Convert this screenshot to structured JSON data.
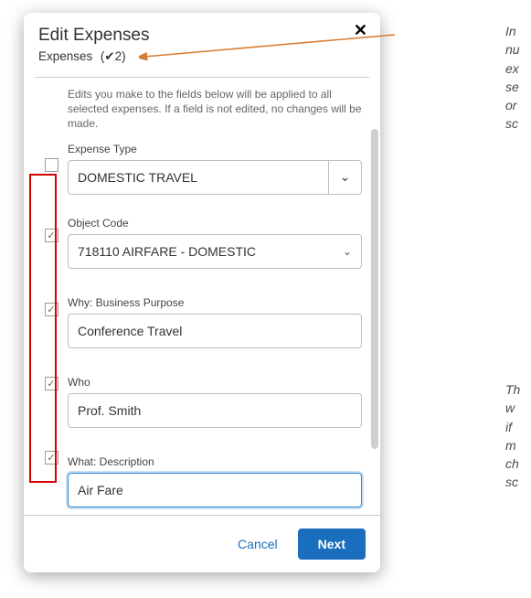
{
  "dialog": {
    "title": "Edit Expenses",
    "subheader_prefix": "Expenses",
    "selected_count": "2",
    "hint": "Edits you make to the fields below will be applied to all selected expenses. If a field is not edited, no changes will be made."
  },
  "fields": {
    "expense_type": {
      "label": "Expense Type",
      "value": "DOMESTIC TRAVEL",
      "checked": false
    },
    "object_code": {
      "label": "Object Code",
      "value": "718110 AIRFARE - DOMESTIC",
      "checked": true
    },
    "why": {
      "label": "Why: Business Purpose",
      "value": "Conference Travel",
      "checked": true
    },
    "who": {
      "label": "Who",
      "value": "Prof. Smith",
      "checked": true
    },
    "what": {
      "label": "What: Description",
      "value": "Air Fare",
      "checked": true
    }
  },
  "footer": {
    "cancel": "Cancel",
    "next": "Next"
  },
  "annotations": {
    "upper": "In\nnu\nex\nse\nor\nsc",
    "lower": "Th\nw\nif\nm\nch\nsc"
  }
}
